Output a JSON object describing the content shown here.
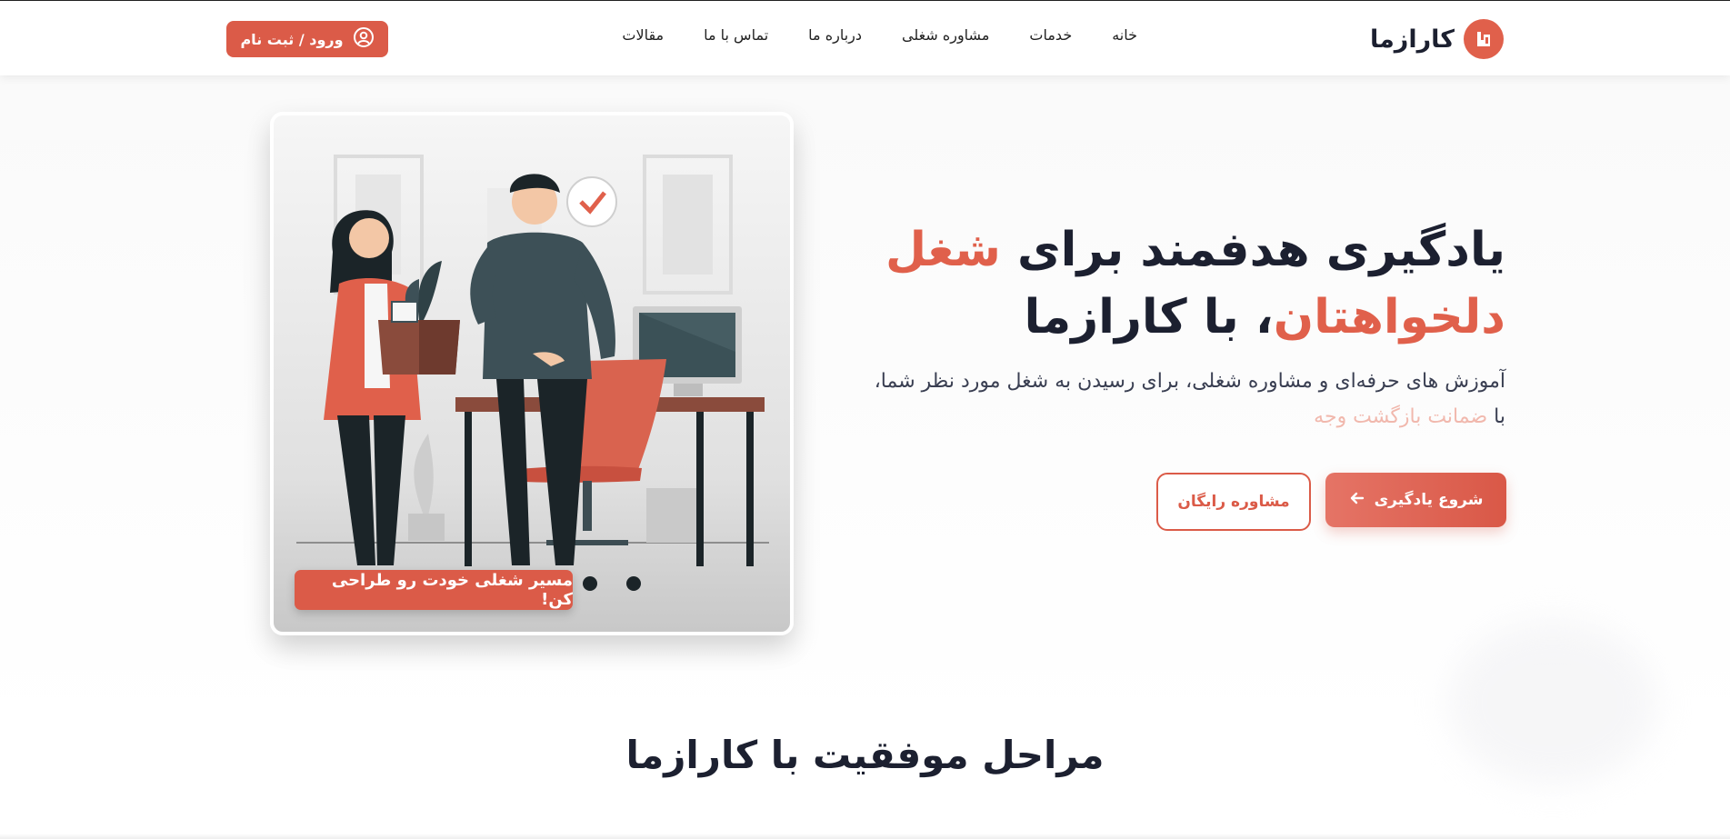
{
  "brand": {
    "name": "کارازما",
    "accent": "#db5b48",
    "icon": "logo-mark-icon"
  },
  "nav": {
    "items": [
      {
        "label": "خانه"
      },
      {
        "label": "خدمات"
      },
      {
        "label": "مشاوره شغلی"
      },
      {
        "label": "درباره ما"
      },
      {
        "label": "تماس با ما"
      },
      {
        "label": "مقالات"
      }
    ],
    "login_label": "ورود / ثبت نام",
    "login_icon": "user-circle-icon"
  },
  "hero": {
    "title_part1": "یادگیری هدفمند برای ",
    "title_accent1": "شغل",
    "title_accent2": "دلخواهتان",
    "title_part2": "، با کارازما",
    "subtitle_main": "آموزش های حرفه‌ای و مشاوره شغلی، برای رسیدن به شغل مورد نظر شما، با ",
    "subtitle_pale": "ضمانت بازگشت وجه",
    "start_button": "شروع یادگیری",
    "start_icon": "arrow-left-icon",
    "consult_button": "مشاوره رایگان",
    "image_caption": "مسیر شغلی خودت رو طراحی کن!"
  },
  "steps": {
    "title": "مراحل موفقیت با کارازما"
  }
}
